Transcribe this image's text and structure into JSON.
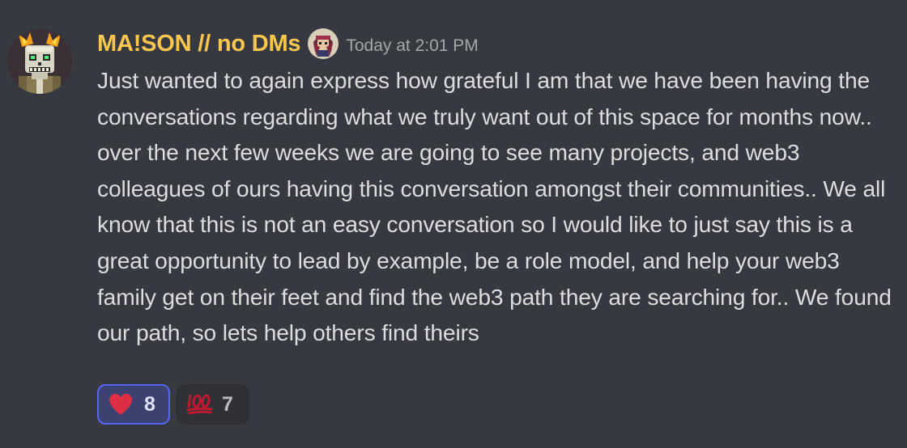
{
  "message": {
    "username": "MA!SON // no DMs",
    "timestamp": "Today at 2:01 PM",
    "content": "Just wanted to again express how grateful I am that we have been having the conversations regarding what we truly want out of this space for months now.. over the next few weeks we are going to see many projects, and web3 colleagues of ours having this conversation amongst their communities.. We all know that this is not an easy conversation so I would like to just say this is a great opportunity to lead by example, be a role model, and help your web3 family get on their feet and find the web3 path they are searching for.. We found our path, so lets help others find theirs"
  },
  "reactions": [
    {
      "emoji": "heart-emoji",
      "count": "8",
      "selected": true
    },
    {
      "emoji": "hundred-points-emoji",
      "count": "7",
      "selected": false
    }
  ],
  "colors": {
    "background": "#36393f",
    "username": "#f9c74f",
    "text": "#dcddde",
    "timestamp": "#a3a6aa",
    "reaction_selected_border": "#5865f2",
    "reaction_selected_bg": "#3c4270",
    "reaction_bg": "#2f3136"
  }
}
